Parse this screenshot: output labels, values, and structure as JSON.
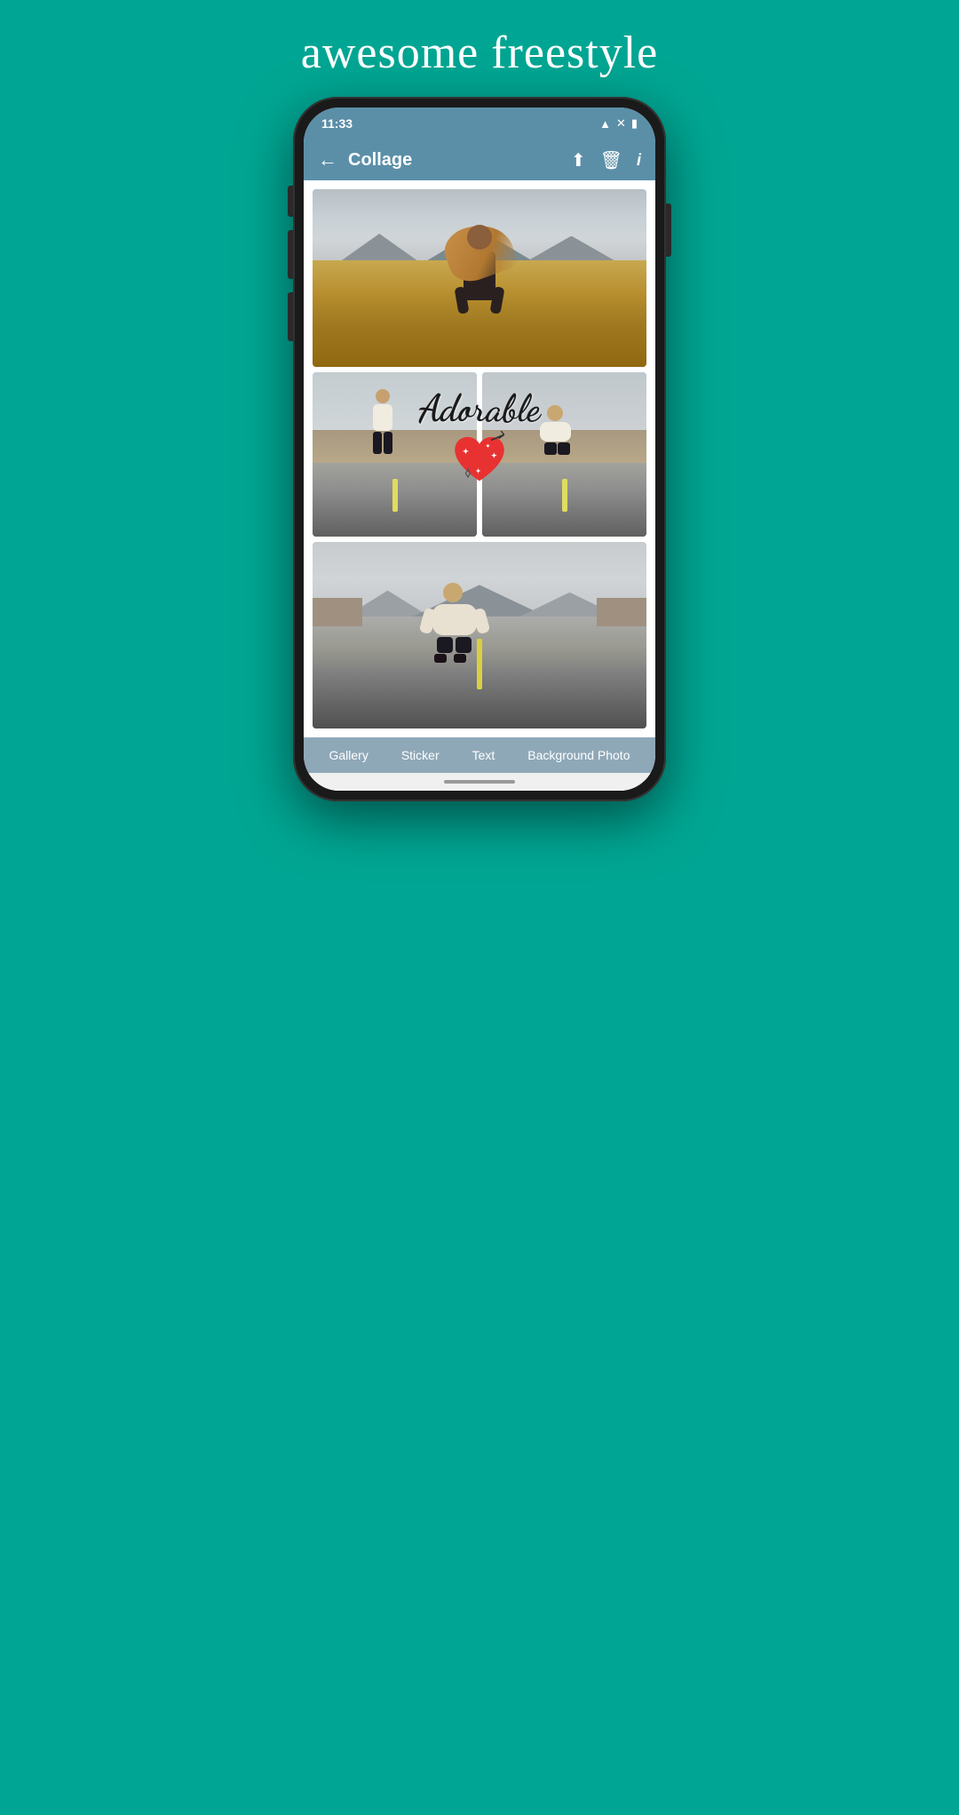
{
  "app": {
    "title": "awesome freestyle",
    "brand_color": "#00A693"
  },
  "status_bar": {
    "time": "11:33",
    "wifi_icon": "wifi",
    "signal_icon": "signal",
    "battery_icon": "battery"
  },
  "header": {
    "back_label": "←",
    "title": "Collage",
    "share_icon": "share",
    "delete_icon": "delete",
    "info_icon": "info"
  },
  "collage": {
    "adorable_text": "Adorable",
    "photo1_alt": "Woman standing in wheat field with mountains",
    "photo2_alt": "Girl on road left side",
    "photo3_alt": "Girl sitting on road right side",
    "photo4_alt": "Girl sitting on road large view"
  },
  "bottom_toolbar": {
    "items": [
      {
        "id": "gallery",
        "label": "Gallery"
      },
      {
        "id": "sticker",
        "label": "Sticker"
      },
      {
        "id": "text",
        "label": "Text"
      },
      {
        "id": "background",
        "label": "Background Photo"
      }
    ]
  }
}
